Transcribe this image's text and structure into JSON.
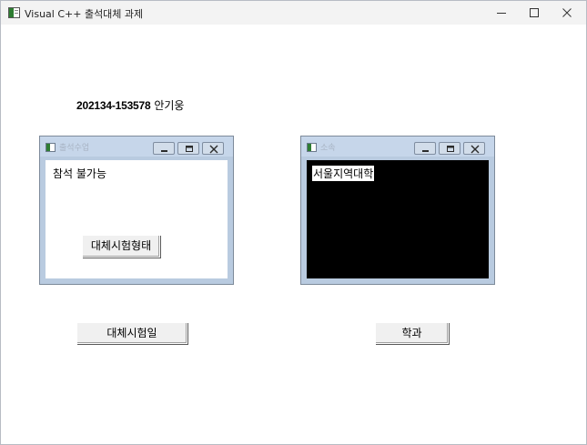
{
  "window": {
    "title": "Visual C++ 출석대체 과제"
  },
  "student": {
    "number": "202134-153578",
    "name": "안기웅"
  },
  "child_left": {
    "title": "출석수업",
    "body_text": "참석 불가능",
    "button_label": "대체시험형태"
  },
  "child_right": {
    "title": "소속",
    "body_text": "서울지역대학"
  },
  "buttons": {
    "exam_date": "대체시험일",
    "department": "학과"
  },
  "colors": {
    "child_frame": "#b9cbe0",
    "right_body": "#000000",
    "left_body": "#ffffff"
  }
}
